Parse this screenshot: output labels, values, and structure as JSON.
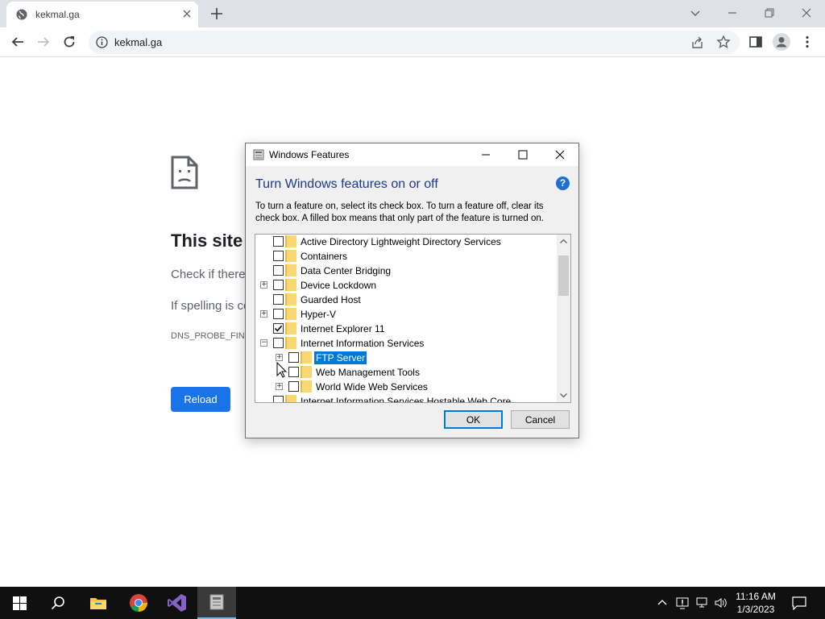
{
  "browser": {
    "tab_title": "kekmal.ga",
    "url": "kekmal.ga"
  },
  "error_page": {
    "title": "This site",
    "check_text": "Check if there",
    "spelling_text": "If spelling is co",
    "error_code": "DNS_PROBE_FINI",
    "reload_label": "Reload"
  },
  "dialog": {
    "window_title": "Windows Features",
    "heading": "Turn Windows features on or off",
    "help_label": "?",
    "description": "To turn a feature on, select its check box. To turn a feature off, clear its check box. A filled box means that only part of the feature is turned on.",
    "features": [
      {
        "label": "Active Directory Lightweight Directory Services",
        "level": 0,
        "expander": "",
        "checked": false,
        "selected": false
      },
      {
        "label": "Containers",
        "level": 0,
        "expander": "",
        "checked": false,
        "selected": false
      },
      {
        "label": "Data Center Bridging",
        "level": 0,
        "expander": "",
        "checked": false,
        "selected": false
      },
      {
        "label": "Device Lockdown",
        "level": 0,
        "expander": "+",
        "checked": false,
        "selected": false
      },
      {
        "label": "Guarded Host",
        "level": 0,
        "expander": "",
        "checked": false,
        "selected": false
      },
      {
        "label": "Hyper-V",
        "level": 0,
        "expander": "+",
        "checked": false,
        "selected": false
      },
      {
        "label": "Internet Explorer 11",
        "level": 0,
        "expander": "",
        "checked": true,
        "selected": false
      },
      {
        "label": "Internet Information Services",
        "level": 0,
        "expander": "-",
        "checked": false,
        "selected": false
      },
      {
        "label": "FTP Server",
        "level": 1,
        "expander": "+",
        "checked": false,
        "selected": true
      },
      {
        "label": "Web Management Tools",
        "level": 1,
        "expander": "",
        "checked": false,
        "selected": false
      },
      {
        "label": "World Wide Web Services",
        "level": 1,
        "expander": "+",
        "checked": false,
        "selected": false
      },
      {
        "label": "Internet Information Services Hostable Web Core",
        "level": 0,
        "expander": "",
        "checked": false,
        "selected": false
      }
    ],
    "ok_label": "OK",
    "cancel_label": "Cancel"
  },
  "taskbar": {
    "apps": [
      {
        "name": "start-icon",
        "active": false
      },
      {
        "name": "search-icon",
        "active": false
      },
      {
        "name": "file-explorer-icon",
        "active": false
      },
      {
        "name": "chrome-icon",
        "active": false
      },
      {
        "name": "visual-studio-icon",
        "active": false
      },
      {
        "name": "server-features-icon",
        "active": true
      }
    ],
    "time": "11:16 AM",
    "date": "1/3/2023"
  },
  "colors": {
    "accent": "#1a73e8",
    "selection": "#0078d7",
    "dialog_heading": "#1e3a8a",
    "taskbar": "#101010"
  }
}
